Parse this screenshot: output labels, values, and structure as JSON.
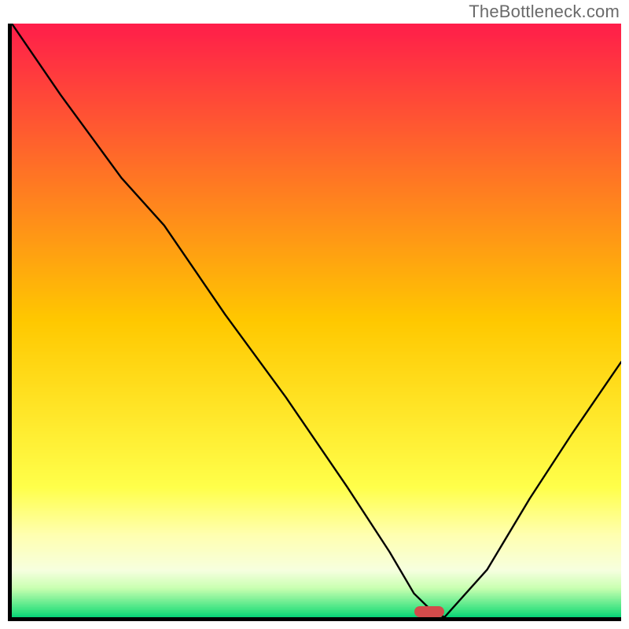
{
  "watermark": "TheBottleneck.com",
  "chart_data": {
    "type": "line",
    "title": "",
    "xlabel": "",
    "ylabel": "",
    "ylim": [
      0,
      100
    ],
    "x": [
      0,
      8,
      18,
      25,
      35,
      45,
      55,
      62,
      66,
      69,
      71,
      78,
      85,
      92,
      100
    ],
    "series": [
      {
        "name": "bottleneck-curve",
        "values": [
          100,
          88,
          74,
          66,
          51,
          37,
          22,
          11,
          4,
          1,
          0,
          8,
          20,
          31,
          43
        ]
      }
    ],
    "optimal_range_pct": [
      67,
      73
    ],
    "gradient_stops": [
      {
        "pct": 0,
        "color": "#ff1e4a"
      },
      {
        "pct": 50,
        "color": "#ffc800"
      },
      {
        "pct": 78,
        "color": "#ffff4a"
      },
      {
        "pct": 86,
        "color": "#ffffb0"
      },
      {
        "pct": 92,
        "color": "#f6ffdf"
      },
      {
        "pct": 95,
        "color": "#c8ffb0"
      },
      {
        "pct": 99,
        "color": "#2de07d"
      },
      {
        "pct": 100,
        "color": "#00d077"
      }
    ],
    "marker": {
      "x_pct": 68.5,
      "width_pct": 5.0,
      "height_frac": 0.019,
      "color": "#d34b4b"
    },
    "axes_visible": false,
    "grid": false
  }
}
